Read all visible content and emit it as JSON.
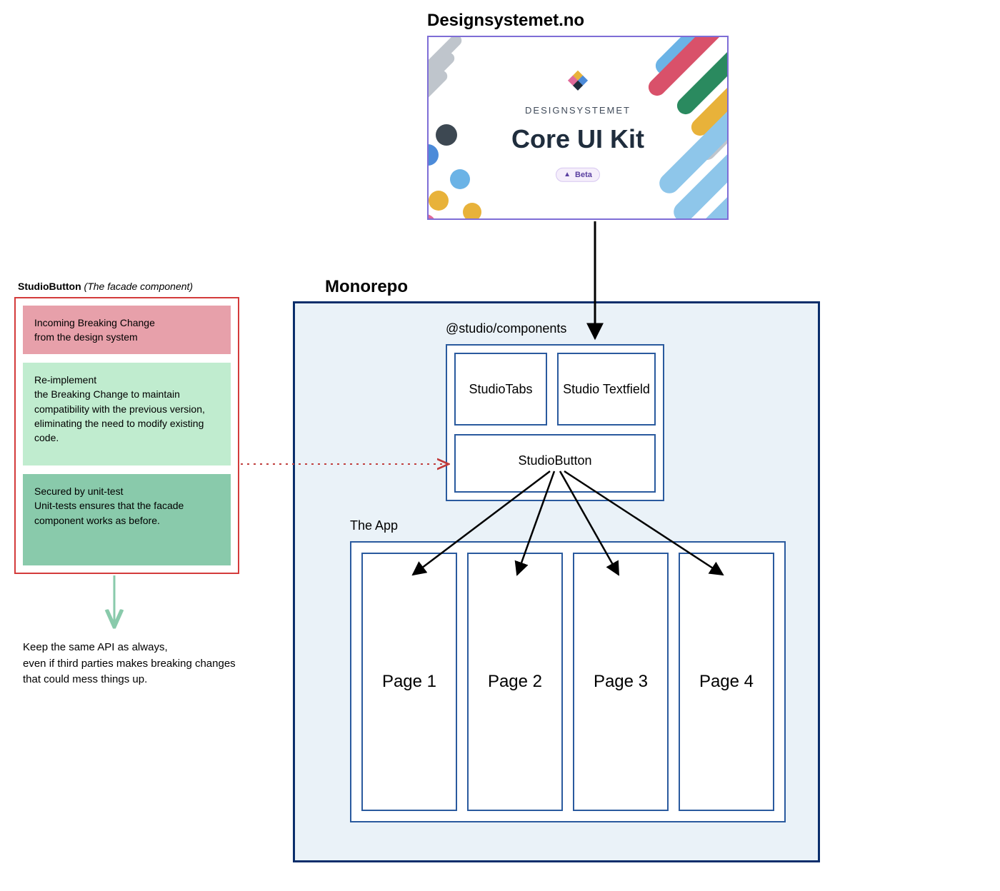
{
  "designsystemet": {
    "external_title": "Designsystemet.no",
    "subheading": "DESIGNSYSTEMET",
    "heading": "Core UI Kit",
    "badge_icon": "▲",
    "badge_text": "Beta"
  },
  "monorepo": {
    "title": "Monorepo",
    "studio_components": {
      "title": "@studio/components",
      "tabs": "StudioTabs",
      "textfield": "Studio Textfield",
      "button": "StudioButton"
    },
    "app": {
      "title": "The App",
      "pages": [
        "Page 1",
        "Page 2",
        "Page 3",
        "Page 4"
      ]
    }
  },
  "facade": {
    "title_bold": "StudioButton",
    "title_italic": "(The facade component)",
    "sections": [
      {
        "heading": "Incoming Breaking Change",
        "body": "from the design system"
      },
      {
        "heading": "Re-implement",
        "body": "the Breaking Change to maintain compatibility with the previous version, eliminating the need to modify existing code."
      },
      {
        "heading": "Secured by unit-test",
        "body": "Unit-tests ensures that the facade component works as before."
      }
    ],
    "note": "Keep the same API as always,\neven if third parties makes breaking changes that could mess things up."
  }
}
